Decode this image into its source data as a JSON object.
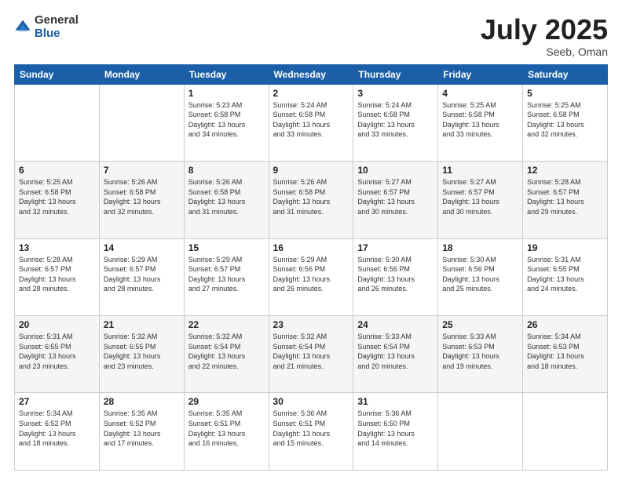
{
  "logo": {
    "general": "General",
    "blue": "Blue"
  },
  "header": {
    "month": "July 2025",
    "location": "Seeb, Oman"
  },
  "weekdays": [
    "Sunday",
    "Monday",
    "Tuesday",
    "Wednesday",
    "Thursday",
    "Friday",
    "Saturday"
  ],
  "weeks": [
    [
      {
        "day": "",
        "info": ""
      },
      {
        "day": "",
        "info": ""
      },
      {
        "day": "1",
        "info": "Sunrise: 5:23 AM\nSunset: 6:58 PM\nDaylight: 13 hours\nand 34 minutes."
      },
      {
        "day": "2",
        "info": "Sunrise: 5:24 AM\nSunset: 6:58 PM\nDaylight: 13 hours\nand 33 minutes."
      },
      {
        "day": "3",
        "info": "Sunrise: 5:24 AM\nSunset: 6:58 PM\nDaylight: 13 hours\nand 33 minutes."
      },
      {
        "day": "4",
        "info": "Sunrise: 5:25 AM\nSunset: 6:58 PM\nDaylight: 13 hours\nand 33 minutes."
      },
      {
        "day": "5",
        "info": "Sunrise: 5:25 AM\nSunset: 6:58 PM\nDaylight: 13 hours\nand 32 minutes."
      }
    ],
    [
      {
        "day": "6",
        "info": "Sunrise: 5:25 AM\nSunset: 6:58 PM\nDaylight: 13 hours\nand 32 minutes."
      },
      {
        "day": "7",
        "info": "Sunrise: 5:26 AM\nSunset: 6:58 PM\nDaylight: 13 hours\nand 32 minutes."
      },
      {
        "day": "8",
        "info": "Sunrise: 5:26 AM\nSunset: 6:58 PM\nDaylight: 13 hours\nand 31 minutes."
      },
      {
        "day": "9",
        "info": "Sunrise: 5:26 AM\nSunset: 6:58 PM\nDaylight: 13 hours\nand 31 minutes."
      },
      {
        "day": "10",
        "info": "Sunrise: 5:27 AM\nSunset: 6:57 PM\nDaylight: 13 hours\nand 30 minutes."
      },
      {
        "day": "11",
        "info": "Sunrise: 5:27 AM\nSunset: 6:57 PM\nDaylight: 13 hours\nand 30 minutes."
      },
      {
        "day": "12",
        "info": "Sunrise: 5:28 AM\nSunset: 6:57 PM\nDaylight: 13 hours\nand 29 minutes."
      }
    ],
    [
      {
        "day": "13",
        "info": "Sunrise: 5:28 AM\nSunset: 6:57 PM\nDaylight: 13 hours\nand 28 minutes."
      },
      {
        "day": "14",
        "info": "Sunrise: 5:29 AM\nSunset: 6:57 PM\nDaylight: 13 hours\nand 28 minutes."
      },
      {
        "day": "15",
        "info": "Sunrise: 5:29 AM\nSunset: 6:57 PM\nDaylight: 13 hours\nand 27 minutes."
      },
      {
        "day": "16",
        "info": "Sunrise: 5:29 AM\nSunset: 6:56 PM\nDaylight: 13 hours\nand 26 minutes."
      },
      {
        "day": "17",
        "info": "Sunrise: 5:30 AM\nSunset: 6:56 PM\nDaylight: 13 hours\nand 26 minutes."
      },
      {
        "day": "18",
        "info": "Sunrise: 5:30 AM\nSunset: 6:56 PM\nDaylight: 13 hours\nand 25 minutes."
      },
      {
        "day": "19",
        "info": "Sunrise: 5:31 AM\nSunset: 6:55 PM\nDaylight: 13 hours\nand 24 minutes."
      }
    ],
    [
      {
        "day": "20",
        "info": "Sunrise: 5:31 AM\nSunset: 6:55 PM\nDaylight: 13 hours\nand 23 minutes."
      },
      {
        "day": "21",
        "info": "Sunrise: 5:32 AM\nSunset: 6:55 PM\nDaylight: 13 hours\nand 23 minutes."
      },
      {
        "day": "22",
        "info": "Sunrise: 5:32 AM\nSunset: 6:54 PM\nDaylight: 13 hours\nand 22 minutes."
      },
      {
        "day": "23",
        "info": "Sunrise: 5:32 AM\nSunset: 6:54 PM\nDaylight: 13 hours\nand 21 minutes."
      },
      {
        "day": "24",
        "info": "Sunrise: 5:33 AM\nSunset: 6:54 PM\nDaylight: 13 hours\nand 20 minutes."
      },
      {
        "day": "25",
        "info": "Sunrise: 5:33 AM\nSunset: 6:53 PM\nDaylight: 13 hours\nand 19 minutes."
      },
      {
        "day": "26",
        "info": "Sunrise: 5:34 AM\nSunset: 6:53 PM\nDaylight: 13 hours\nand 18 minutes."
      }
    ],
    [
      {
        "day": "27",
        "info": "Sunrise: 5:34 AM\nSunset: 6:52 PM\nDaylight: 13 hours\nand 18 minutes."
      },
      {
        "day": "28",
        "info": "Sunrise: 5:35 AM\nSunset: 6:52 PM\nDaylight: 13 hours\nand 17 minutes."
      },
      {
        "day": "29",
        "info": "Sunrise: 5:35 AM\nSunset: 6:51 PM\nDaylight: 13 hours\nand 16 minutes."
      },
      {
        "day": "30",
        "info": "Sunrise: 5:36 AM\nSunset: 6:51 PM\nDaylight: 13 hours\nand 15 minutes."
      },
      {
        "day": "31",
        "info": "Sunrise: 5:36 AM\nSunset: 6:50 PM\nDaylight: 13 hours\nand 14 minutes."
      },
      {
        "day": "",
        "info": ""
      },
      {
        "day": "",
        "info": ""
      }
    ]
  ]
}
